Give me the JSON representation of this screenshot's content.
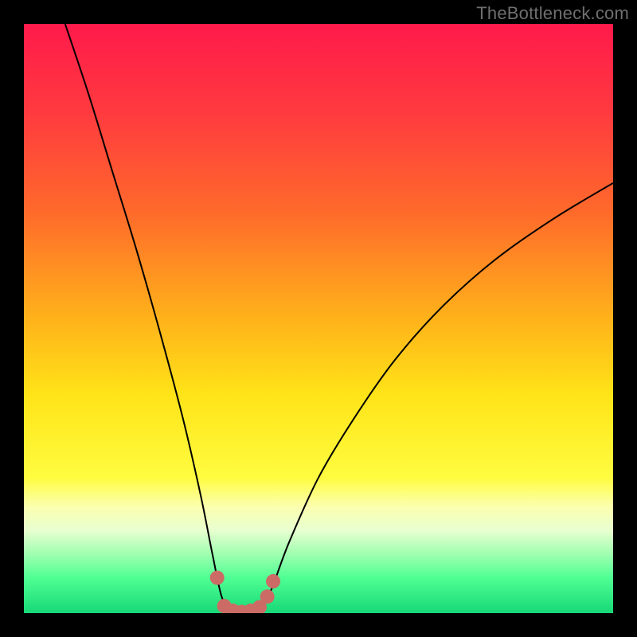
{
  "watermark": "TheBottleneck.com",
  "chart_data": {
    "type": "line",
    "title": "",
    "xlabel": "",
    "ylabel": "",
    "xlim": [
      0,
      100
    ],
    "ylim": [
      0,
      100
    ],
    "gradient_stops": [
      {
        "offset": 0.0,
        "color": "#ff1a4b"
      },
      {
        "offset": 0.15,
        "color": "#ff3a3f"
      },
      {
        "offset": 0.32,
        "color": "#ff6a2b"
      },
      {
        "offset": 0.5,
        "color": "#ffb21a"
      },
      {
        "offset": 0.63,
        "color": "#ffe418"
      },
      {
        "offset": 0.77,
        "color": "#fffc40"
      },
      {
        "offset": 0.82,
        "color": "#fbffb0"
      },
      {
        "offset": 0.86,
        "color": "#e8ffd0"
      },
      {
        "offset": 0.9,
        "color": "#9fffb0"
      },
      {
        "offset": 0.94,
        "color": "#4fff93"
      },
      {
        "offset": 1.0,
        "color": "#17d877"
      }
    ],
    "series": [
      {
        "name": "bottleneck-curve-left",
        "type": "line",
        "stroke": "#000000",
        "stroke_width": 2,
        "points": [
          {
            "x": 7.0,
            "y": 100.0
          },
          {
            "x": 11.0,
            "y": 88.0
          },
          {
            "x": 15.0,
            "y": 75.0
          },
          {
            "x": 19.0,
            "y": 62.0
          },
          {
            "x": 23.0,
            "y": 48.0
          },
          {
            "x": 27.0,
            "y": 33.0
          },
          {
            "x": 30.0,
            "y": 20.0
          },
          {
            "x": 32.0,
            "y": 10.0
          },
          {
            "x": 33.5,
            "y": 3.0
          },
          {
            "x": 35.0,
            "y": 0.0
          }
        ]
      },
      {
        "name": "bottleneck-curve-right",
        "type": "line",
        "stroke": "#000000",
        "stroke_width": 2,
        "points": [
          {
            "x": 40.0,
            "y": 0.0
          },
          {
            "x": 42.0,
            "y": 4.0
          },
          {
            "x": 45.0,
            "y": 12.0
          },
          {
            "x": 50.0,
            "y": 23.0
          },
          {
            "x": 56.0,
            "y": 33.0
          },
          {
            "x": 63.0,
            "y": 43.0
          },
          {
            "x": 71.0,
            "y": 52.0
          },
          {
            "x": 80.0,
            "y": 60.0
          },
          {
            "x": 90.0,
            "y": 67.0
          },
          {
            "x": 100.0,
            "y": 73.0
          }
        ]
      },
      {
        "name": "optimal-band-markers",
        "type": "scatter",
        "stroke": "#cc6b66",
        "marker_radius": 9,
        "points": [
          {
            "x": 32.8,
            "y": 6.0
          },
          {
            "x": 34.0,
            "y": 1.2
          },
          {
            "x": 35.5,
            "y": 0.4
          },
          {
            "x": 37.0,
            "y": 0.2
          },
          {
            "x": 38.5,
            "y": 0.4
          },
          {
            "x": 40.0,
            "y": 1.0
          },
          {
            "x": 41.3,
            "y": 2.8
          },
          {
            "x": 42.3,
            "y": 5.4
          }
        ]
      }
    ]
  }
}
